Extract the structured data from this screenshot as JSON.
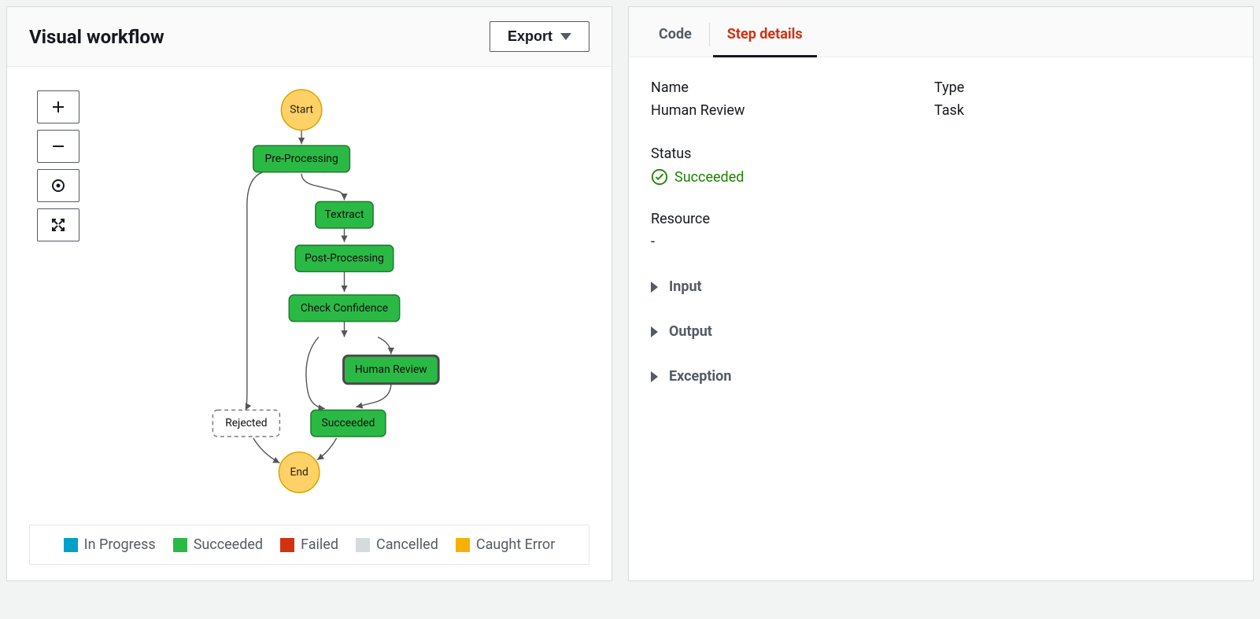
{
  "left": {
    "title": "Visual workflow",
    "export_label": "Export"
  },
  "workflow": {
    "start": "Start",
    "end": "End",
    "nodes": {
      "preprocessing": "Pre-Processing",
      "textract": "Textract",
      "postprocessing": "Post-Processing",
      "check_confidence": "Check Confidence",
      "human_review": "Human Review",
      "succeeded": "Succeeded",
      "rejected": "Rejected"
    }
  },
  "legend": {
    "in_progress": {
      "label": "In Progress",
      "color": "#00a1c9"
    },
    "succeeded": {
      "label": "Succeeded",
      "color": "#2bb946"
    },
    "failed": {
      "label": "Failed",
      "color": "#d13212"
    },
    "cancelled": {
      "label": "Cancelled",
      "color": "#d5dbdb"
    },
    "caught": {
      "label": "Caught Error",
      "color": "#f6b200"
    }
  },
  "tabs": {
    "code": "Code",
    "step_details": "Step details"
  },
  "details": {
    "name_label": "Name",
    "name_value": "Human Review",
    "type_label": "Type",
    "type_value": "Task",
    "status_label": "Status",
    "status_value": "Succeeded",
    "resource_label": "Resource",
    "resource_value": "-",
    "input_label": "Input",
    "output_label": "Output",
    "exception_label": "Exception"
  }
}
